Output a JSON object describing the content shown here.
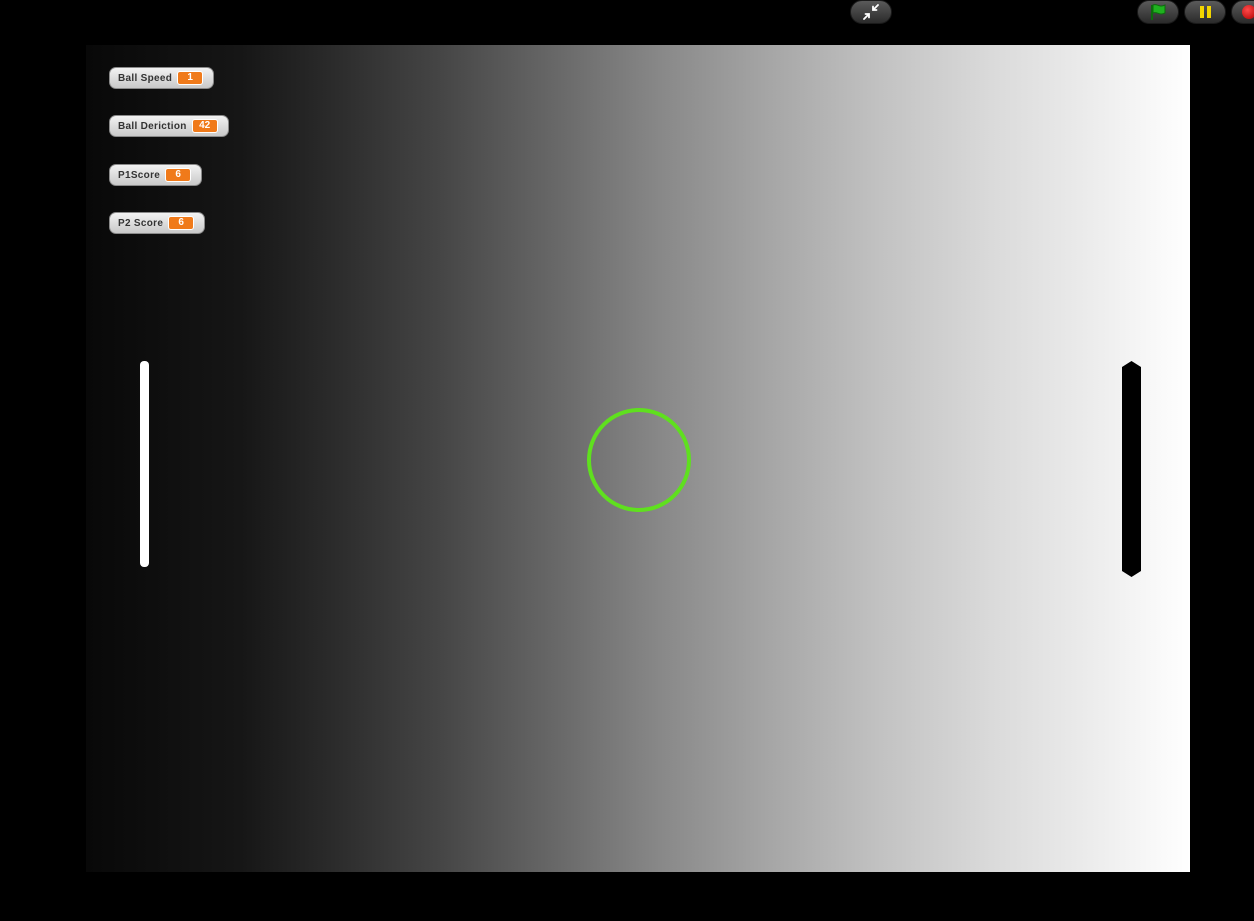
{
  "controls": {
    "unfullscreen_icon": "shrink-arrows-icon",
    "green_flag_icon": "green-flag-icon",
    "pause_icon": "pause-icon",
    "stop_icon": "stop-sign-icon",
    "colors": {
      "flag": "#1fb21f",
      "pause": "#f2d500",
      "stop": "#d00000"
    }
  },
  "monitors": [
    {
      "label": "Ball Speed",
      "value": "1"
    },
    {
      "label": "Ball Deriction",
      "value": "42"
    },
    {
      "label": "P1Score",
      "value": "6"
    },
    {
      "label": "P2 Score",
      "value": "6"
    }
  ],
  "sprites": {
    "ball": {
      "color": "#5fe01e",
      "shape": "ring"
    },
    "paddle_left": {
      "color": "#ffffff"
    },
    "paddle_right": {
      "color": "#000000"
    }
  },
  "stage": {
    "background": "horizontal gradient black to white"
  }
}
